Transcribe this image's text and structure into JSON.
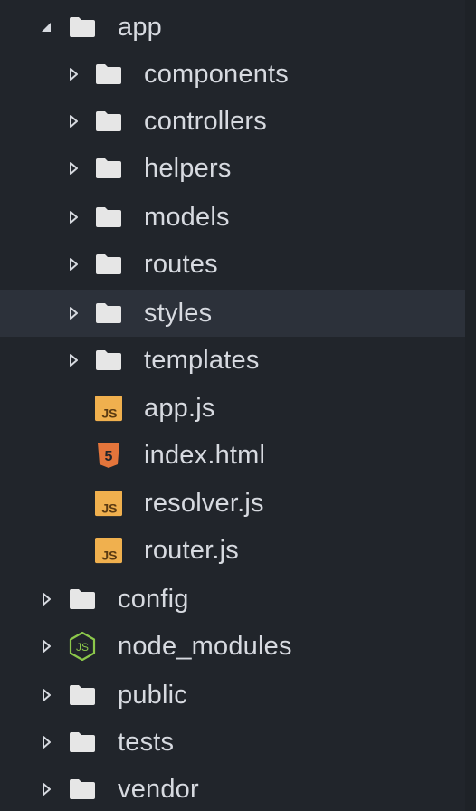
{
  "colors": {
    "background": "#21252b",
    "selected_row": "#2c313a",
    "text": "#d7dae0",
    "folder": "#e6e6e6",
    "js_badge": "#f0b04e",
    "html5": "#e4753b",
    "node": "#8cc84b"
  },
  "tree": {
    "root": {
      "label": "app",
      "expanded": true,
      "icon": "folder-icon",
      "children": [
        {
          "label": "components",
          "type": "folder",
          "icon": "folder-icon"
        },
        {
          "label": "controllers",
          "type": "folder",
          "icon": "folder-icon"
        },
        {
          "label": "helpers",
          "type": "folder",
          "icon": "folder-icon"
        },
        {
          "label": "models",
          "type": "folder",
          "icon": "folder-icon"
        },
        {
          "label": "routes",
          "type": "folder",
          "icon": "folder-icon"
        },
        {
          "label": "styles",
          "type": "folder",
          "icon": "folder-icon",
          "selected": true
        },
        {
          "label": "templates",
          "type": "folder",
          "icon": "folder-icon"
        },
        {
          "label": "app.js",
          "type": "file",
          "icon": "js-file-icon",
          "badge": "JS"
        },
        {
          "label": "index.html",
          "type": "file",
          "icon": "html5-file-icon",
          "badge": "5"
        },
        {
          "label": "resolver.js",
          "type": "file",
          "icon": "js-file-icon",
          "badge": "JS"
        },
        {
          "label": "router.js",
          "type": "file",
          "icon": "js-file-icon",
          "badge": "JS"
        }
      ]
    },
    "siblings": [
      {
        "label": "config",
        "type": "folder",
        "icon": "folder-icon"
      },
      {
        "label": "node_modules",
        "type": "folder",
        "icon": "nodejs-icon",
        "badge": "JS"
      },
      {
        "label": "public",
        "type": "folder",
        "icon": "folder-icon"
      },
      {
        "label": "tests",
        "type": "folder",
        "icon": "folder-icon"
      },
      {
        "label": "vendor",
        "type": "folder",
        "icon": "folder-icon"
      }
    ]
  }
}
